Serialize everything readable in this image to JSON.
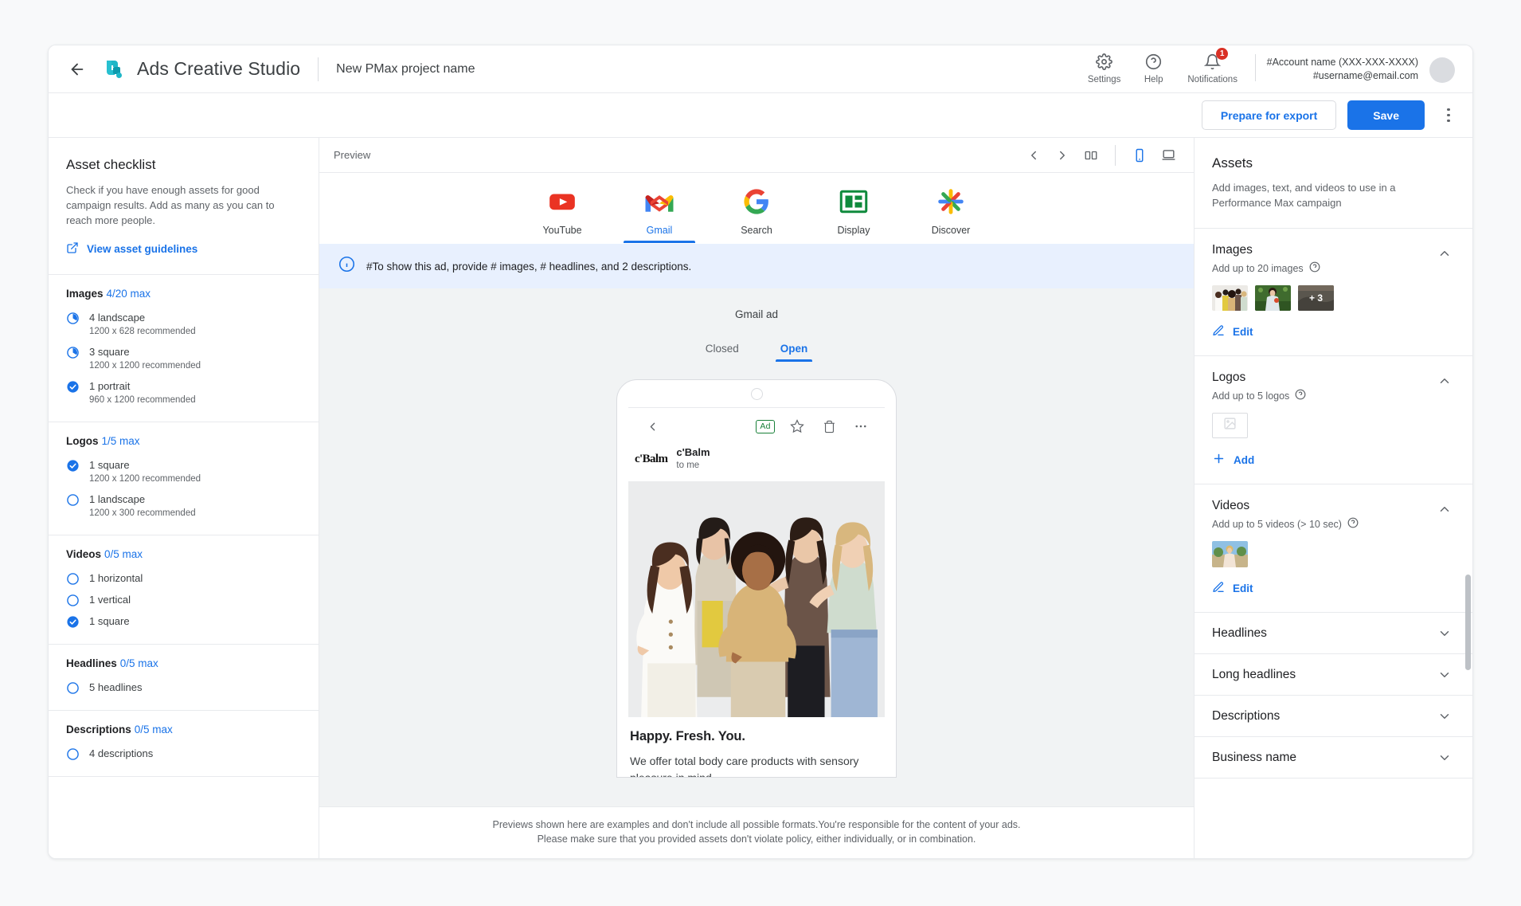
{
  "topbar": {
    "back_icon": "back-arrow-icon",
    "brand": "Ads Creative Studio",
    "project_name": "New PMax project name",
    "settings_label": "Settings",
    "help_label": "Help",
    "notifications_label": "Notifications",
    "notifications_count": "1",
    "account_name": "#Account name (XXX-XXX-XXXX)",
    "account_email": "#username@email.com"
  },
  "actionbar": {
    "prepare_label": "Prepare for export",
    "save_label": "Save"
  },
  "sidebar": {
    "title": "Asset checklist",
    "description": "Check if you have enough assets for good campaign results. Add as many as you can to reach more people.",
    "guidelines_link": "View asset guidelines",
    "groups": [
      {
        "name": "Images",
        "count": "4/20 max",
        "items": [
          {
            "label": "4 landscape",
            "hint": "1200 x 628 recommended",
            "state": "partial"
          },
          {
            "label": "3 square",
            "hint": "1200 x 1200 recommended",
            "state": "partial"
          },
          {
            "label": "1 portrait",
            "hint": "960 x 1200 recommended",
            "state": "done"
          }
        ]
      },
      {
        "name": "Logos",
        "count": "1/5 max",
        "items": [
          {
            "label": "1 square",
            "hint": "1200 x 1200 recommended",
            "state": "done"
          },
          {
            "label": "1 landscape",
            "hint": "1200 x 300 recommended",
            "state": "empty"
          }
        ]
      },
      {
        "name": "Videos",
        "count": "0/5 max",
        "items": [
          {
            "label": "1 horizontal",
            "hint": "",
            "state": "empty"
          },
          {
            "label": "1 vertical",
            "hint": "",
            "state": "empty"
          },
          {
            "label": "1 square",
            "hint": "",
            "state": "done"
          }
        ]
      },
      {
        "name": "Headlines",
        "count": "0/5 max",
        "items": [
          {
            "label": "5 headlines",
            "hint": "",
            "state": "empty"
          }
        ]
      },
      {
        "name": "Descriptions",
        "count": "0/5 max",
        "items": [
          {
            "label": "4 descriptions",
            "hint": "",
            "state": "empty"
          }
        ]
      }
    ]
  },
  "preview": {
    "label": "Preview",
    "platforms": [
      {
        "label": "YouTube",
        "icon": "youtube-icon",
        "active": false
      },
      {
        "label": "Gmail",
        "icon": "gmail-icon",
        "active": true
      },
      {
        "label": "Search",
        "icon": "google-search-icon",
        "active": false
      },
      {
        "label": "Display",
        "icon": "display-icon",
        "active": false
      },
      {
        "label": "Discover",
        "icon": "discover-icon",
        "active": false
      }
    ],
    "info_message": "#To show this ad, provide # images, # headlines, and 2 descriptions.",
    "stage_title": "Gmail ad",
    "segments": [
      {
        "label": "Closed",
        "active": false
      },
      {
        "label": "Open",
        "active": true
      }
    ],
    "ad": {
      "ad_badge": "Ad",
      "sender_logo": "c'Balm",
      "sender_name": "c'Balm",
      "sender_to": "to me",
      "headline": "Happy. Fresh. You.",
      "description": "We offer total body care products with sensory pleasure in mind."
    },
    "footer_line1": "Previews shown here are examples and don't include all possible formats.You're responsible for the content of your ads.",
    "footer_line2": "Please make sure that you provided assets don't violate policy, either individually, or in combination."
  },
  "assets": {
    "title": "Assets",
    "description": "Add images, text, and videos to use in a Performance Max campaign",
    "sections": [
      {
        "name": "Images",
        "subtitle": "Add up to 20 images",
        "action": "Edit",
        "more_label": "+ 3"
      },
      {
        "name": "Logos",
        "subtitle": "Add up to 5 logos",
        "action": "Add"
      },
      {
        "name": "Videos",
        "subtitle": "Add up to 5 videos (> 10 sec)",
        "action": "Edit"
      }
    ],
    "collapsed": [
      {
        "name": "Headlines"
      },
      {
        "name": "Long headlines"
      },
      {
        "name": "Descriptions"
      },
      {
        "name": "Business name"
      }
    ]
  },
  "colors": {
    "accent": "#1a73e8",
    "info_bg": "#e8f0fe",
    "badge": "#d93025",
    "canvas": "#f1f3f4",
    "ad_green": "#188038"
  }
}
